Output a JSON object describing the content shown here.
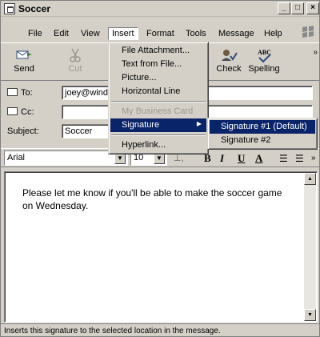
{
  "window": {
    "title": "Soccer",
    "controls": {
      "minimize": "_",
      "maximize": "□",
      "close": "×"
    }
  },
  "menubar": {
    "items": [
      "File",
      "Edit",
      "View",
      "Insert",
      "Format",
      "Tools",
      "Message",
      "Help"
    ],
    "active": "Insert"
  },
  "toolbar": {
    "send": "Send",
    "cut": "Cut",
    "check": "Check",
    "spelling": "Spelling",
    "spelling_icon_text": "ABC",
    "overflow": "»"
  },
  "address": {
    "to_label": "To:",
    "to_value": "joey@wind",
    "cc_label": "Cc:",
    "cc_value": "",
    "subject_label": "Subject:",
    "subject_value": "Soccer"
  },
  "format": {
    "font": "Arial",
    "size": "10",
    "bold": "B",
    "italic": "I",
    "underline": "U",
    "color": "A",
    "overflow": "»"
  },
  "message_body": "Please let me know if you'll be able to make the soccer game on Wednesday.",
  "status": "Inserts this signature to the selected location in the message.",
  "insert_menu": {
    "items": [
      {
        "label": "File Attachment...",
        "disabled": false
      },
      {
        "label": "Text from File...",
        "disabled": false
      },
      {
        "label": "Picture...",
        "disabled": false
      },
      {
        "label": "Horizontal Line",
        "disabled": false
      },
      {
        "label": "My Business Card",
        "disabled": true
      },
      {
        "label": "Signature",
        "disabled": false,
        "highlighted": true
      },
      {
        "label": "Hyperlink...",
        "disabled": false
      }
    ]
  },
  "signature_submenu": {
    "items": [
      {
        "label": "Signature #1 (Default)",
        "highlighted": true
      },
      {
        "label": "Signature #2",
        "highlighted": false
      }
    ]
  },
  "colors": {
    "highlight": "#0a246a",
    "face": "#d4d0c8"
  }
}
